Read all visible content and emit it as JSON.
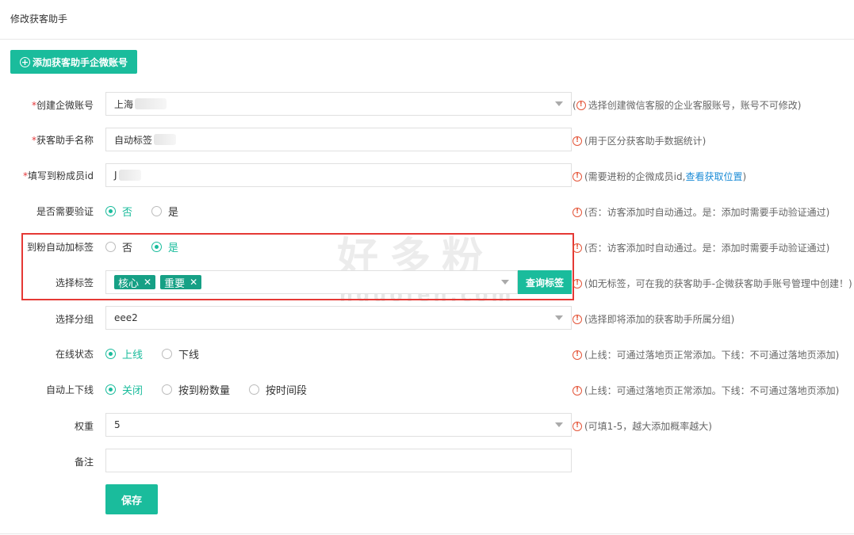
{
  "page": {
    "title": "修改获客助手"
  },
  "toolbar": {
    "add_button_label": "添加获客助手企微账号"
  },
  "form": {
    "account": {
      "label": "创建企微账号",
      "value": "上海",
      "hint": "选择创建微信客服的企业客服账号，账号不可修改)",
      "hint_prefix": "("
    },
    "name": {
      "label": "获客助手名称",
      "value": "自动标签",
      "hint": "(用于区分获客助手数据统计)"
    },
    "member": {
      "label": "填写到粉成员id",
      "value": "J",
      "hint": "(需要进粉的企微成员id, ",
      "hint_link": "查看获取位置",
      "hint_suffix": ")"
    },
    "verify": {
      "label": "是否需要验证",
      "options": [
        "否",
        "是"
      ],
      "selected": "否",
      "hint": "(否：访客添加时自动通过。是：添加时需要手动验证通过)"
    },
    "auto_tag": {
      "label": "到粉自动加标签",
      "options": [
        "否",
        "是"
      ],
      "selected": "是",
      "hint": "(否：访客添加时自动通过。是：添加时需要手动验证通过)"
    },
    "tags": {
      "label": "选择标签",
      "selected": [
        "核心",
        "重要"
      ],
      "query_button": "查询标签",
      "hint": "(如无标签，可在我的获客助手-企微获客助手账号管理中创建！)"
    },
    "group": {
      "label": "选择分组",
      "value": "eee2",
      "hint": "(选择即将添加的获客助手所属分组)"
    },
    "online": {
      "label": "在线状态",
      "options": [
        "上线",
        "下线"
      ],
      "selected": "上线",
      "hint": "(上线：可通过落地页正常添加。下线：不可通过落地页添加)"
    },
    "auto_switch": {
      "label": "自动上下线",
      "options": [
        "关闭",
        "按到粉数量",
        "按时间段"
      ],
      "selected": "关闭",
      "hint": "(上线：可通过落地页正常添加。下线：不可通过落地页添加)"
    },
    "weight": {
      "label": "权重",
      "value": "5",
      "hint": "(可填1-5，越大添加概率越大)"
    },
    "remark": {
      "label": "备注",
      "value": ""
    },
    "required_mark": "*",
    "warn_glyph": "!",
    "tag_remove_glyph": "✕",
    "save_label": "保存"
  },
  "watermark": {
    "main": "好多粉",
    "sub": "hduofen.com"
  },
  "colors": {
    "accent": "#1abc9c",
    "tag": "#16a085",
    "required": "#e4393c",
    "warning": "#e4563a",
    "link": "#1a8bd6",
    "highlight": "#e53935"
  }
}
